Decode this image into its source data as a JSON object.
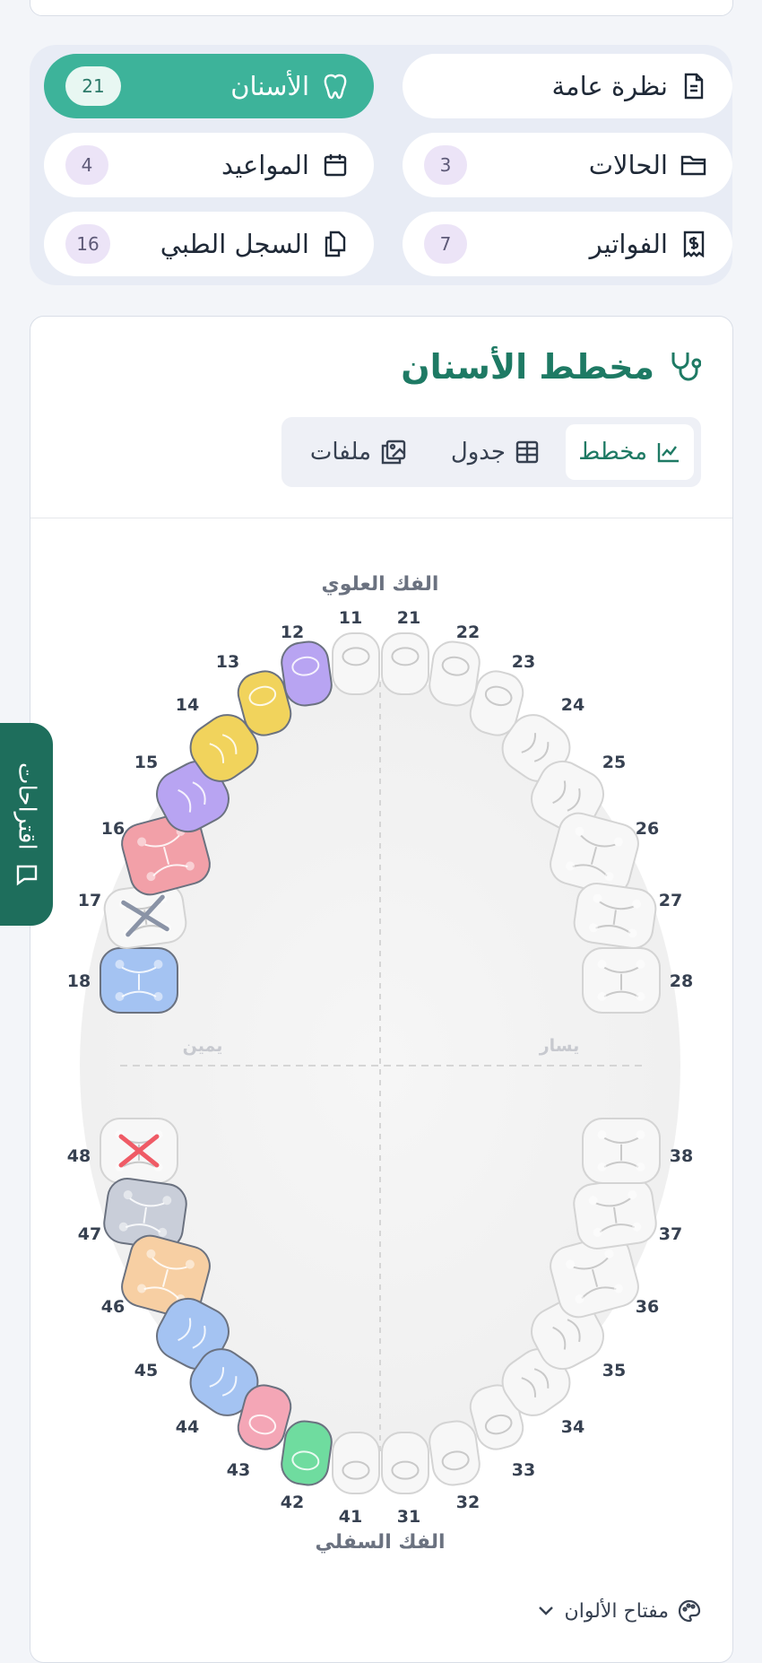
{
  "tabs": [
    {
      "label": "نظرة عامة",
      "badge": "",
      "icon": "document-icon",
      "active": false
    },
    {
      "label": "الأسنان",
      "badge": "21",
      "icon": "tooth-icon",
      "active": true
    },
    {
      "label": "الحالات",
      "badge": "3",
      "icon": "folder-icon",
      "active": false
    },
    {
      "label": "المواعيد",
      "badge": "4",
      "icon": "calendar-icon",
      "active": false
    },
    {
      "label": "الفواتير",
      "badge": "7",
      "icon": "receipt-icon",
      "active": false
    },
    {
      "label": "السجل الطبي",
      "badge": "16",
      "icon": "files-icon",
      "active": false
    }
  ],
  "chart_section": {
    "title": "مخطط الأسنان",
    "title_icon": "stethoscope-icon",
    "views": [
      {
        "label": "مخطط",
        "icon": "chart-icon",
        "active": true
      },
      {
        "label": "جدول",
        "icon": "table-icon",
        "active": false
      },
      {
        "label": "ملفات",
        "icon": "image-files-icon",
        "active": false
      }
    ],
    "upper_jaw_label": "الفك العلوي",
    "lower_jaw_label": "الفك السفلي",
    "right_side_label": "يمين",
    "left_side_label": "يسار",
    "legend_toggle_label": "مفتاح الألوان"
  },
  "side_tab": {
    "label": "اقتراحات",
    "icon": "message-icon"
  },
  "colors": {
    "accent": "#3db39a",
    "title_green": "#1e7a64",
    "purple": "#b8a4f2",
    "yellow": "#f1d35c",
    "red": "#f2a0a8",
    "blue": "#a4c3f2",
    "gray": "#c9ced9",
    "peach": "#f7cfa3",
    "green": "#6fdc9f",
    "pink": "#f4a6b6",
    "white": "#f7f7f7"
  },
  "teeth_upper": [
    {
      "number": "18",
      "status": "blue"
    },
    {
      "number": "17",
      "status": "missing-gray-x"
    },
    {
      "number": "16",
      "status": "red"
    },
    {
      "number": "15",
      "status": "purple"
    },
    {
      "number": "14",
      "status": "yellow"
    },
    {
      "number": "13",
      "status": "yellow"
    },
    {
      "number": "12",
      "status": "purple"
    },
    {
      "number": "11",
      "status": "white"
    },
    {
      "number": "21",
      "status": "white"
    },
    {
      "number": "22",
      "status": "white"
    },
    {
      "number": "23",
      "status": "white"
    },
    {
      "number": "24",
      "status": "white"
    },
    {
      "number": "25",
      "status": "white"
    },
    {
      "number": "26",
      "status": "white"
    },
    {
      "number": "27",
      "status": "white"
    },
    {
      "number": "28",
      "status": "white"
    }
  ],
  "teeth_lower": [
    {
      "number": "48",
      "status": "missing-red-x"
    },
    {
      "number": "47",
      "status": "gray"
    },
    {
      "number": "46",
      "status": "peach"
    },
    {
      "number": "45",
      "status": "blue"
    },
    {
      "number": "44",
      "status": "blue"
    },
    {
      "number": "43",
      "status": "pink"
    },
    {
      "number": "42",
      "status": "green"
    },
    {
      "number": "41",
      "status": "white"
    },
    {
      "number": "31",
      "status": "white"
    },
    {
      "number": "32",
      "status": "white"
    },
    {
      "number": "33",
      "status": "white"
    },
    {
      "number": "34",
      "status": "white"
    },
    {
      "number": "35",
      "status": "white"
    },
    {
      "number": "36",
      "status": "white"
    },
    {
      "number": "37",
      "status": "white"
    },
    {
      "number": "38",
      "status": "white"
    }
  ]
}
